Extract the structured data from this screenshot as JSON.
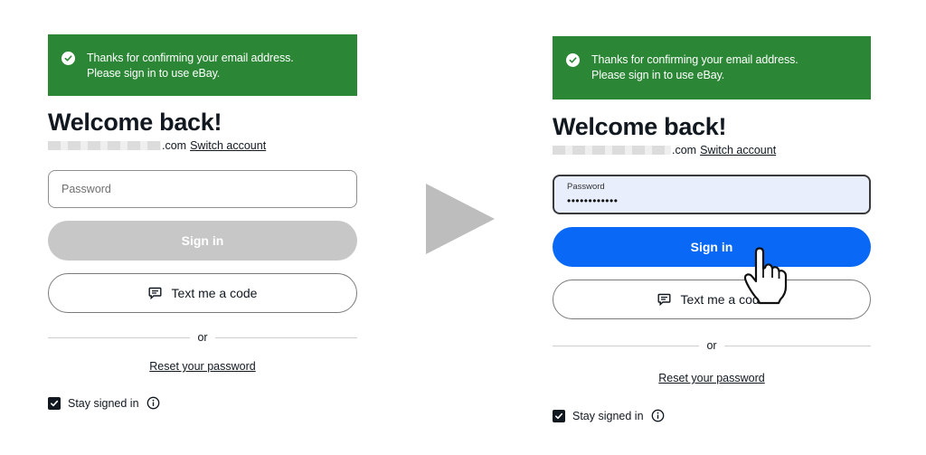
{
  "before": {
    "banner_line1": "Thanks for confirming your email address.",
    "banner_line2": "Please sign in to use eBay.",
    "title": "Welcome back!",
    "account_suffix": ".com",
    "switch_account": "Switch account",
    "password_placeholder": "Password",
    "sign_in": "Sign in",
    "text_code": "Text me a code",
    "or": "or",
    "reset": "Reset your password",
    "stay_signed_in": "Stay signed in"
  },
  "after": {
    "banner_line1": "Thanks for confirming your email address.",
    "banner_line2": "Please sign in to use eBay.",
    "title": "Welcome back!",
    "account_suffix": ".com",
    "switch_account": "Switch account",
    "password_label": "Password",
    "password_value": "••••••••••••",
    "sign_in": "Sign in",
    "text_code": "Text me a code",
    "or": "or",
    "reset": "Reset your password",
    "stay_signed_in": "Stay signed in"
  },
  "colors": {
    "banner_green": "#2b8735",
    "primary_blue": "#0968f6",
    "disabled_gray": "#c7c7c7",
    "arrow_gray": "#bdbdbd"
  },
  "icons": [
    "check-circle-icon",
    "message-icon",
    "checkbox-checked-icon",
    "info-icon",
    "play-arrow-icon",
    "hand-pointer-icon"
  ]
}
